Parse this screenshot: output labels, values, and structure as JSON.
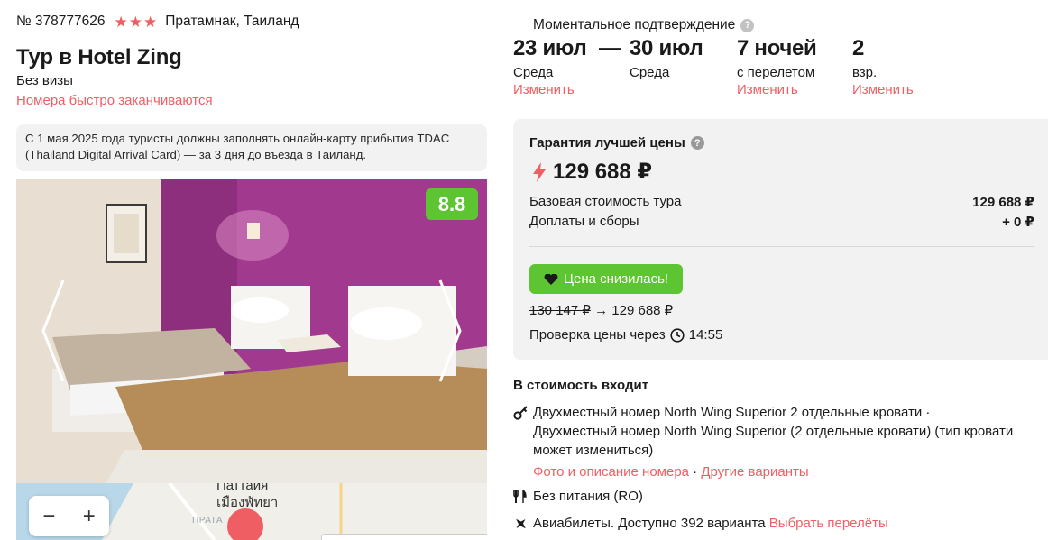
{
  "tour": {
    "number": "№ 378777626",
    "stars": 3,
    "location": "Пратамнак, Таиланд",
    "title": "Тур в Hotel Zing",
    "visa": "Без визы",
    "urgency": "Номера быстро заканчиваются",
    "notice": "С 1 мая 2025 года туристы должны заполнять онлайн-карту прибытия TDAC (Thailand Digital Arrival Card) — за 3 дня до въезда в Таиланд."
  },
  "gallery": {
    "rating": "8.8",
    "prev_icon": "chevron-left-icon",
    "next_icon": "chevron-right-icon"
  },
  "map": {
    "label_line1": "Паттайя",
    "label_line2": "เมืองพัทยา",
    "label_small": "ПРАТА",
    "zoom_out": "−",
    "zoom_in": "+"
  },
  "booking": {
    "instant_confirm": "Моментальное подтверждение",
    "help_icon": "?",
    "date_from": "23 июл",
    "date_from_day": "Среда",
    "date_to": "30 июл",
    "date_to_day": "Среда",
    "dash": "—",
    "nights": "7 ночей",
    "nights_note": "с перелетом",
    "guests": "2",
    "guests_note": "взр.",
    "change_link": "Изменить"
  },
  "price": {
    "guarantee": "Гарантия лучшей цены",
    "total": "129 688 ₽",
    "base_label": "Базовая стоимость тура",
    "base_value": "129 688 ₽",
    "fees_label": "Доплаты и сборы",
    "fees_value": "+ 0 ₽",
    "drop_badge": "Цена снизилась!",
    "old_price": "130 147 ₽",
    "arrow": "→",
    "new_price": "129 688 ₽",
    "check_label": "Проверка цены через",
    "check_time": "14:55",
    "accent_color": "#ef5e63",
    "green_color": "#5cc531"
  },
  "includes": {
    "title": "В стоимость входит",
    "room_line1": "Двухместный номер North Wing Superior 2 отдельные кровати ·",
    "room_line2": "Двухместный номер North Wing Superior (2 отдельные кровати) (тип кровати может измениться)",
    "room_photo_link": "Фото и описание номера",
    "sep": " · ",
    "room_other_link": "Другие варианты",
    "meal": "Без питания (RO)",
    "flights": "Авиабилеты. Доступно 392 варианта",
    "flights_link": "Выбрать перелёты"
  }
}
